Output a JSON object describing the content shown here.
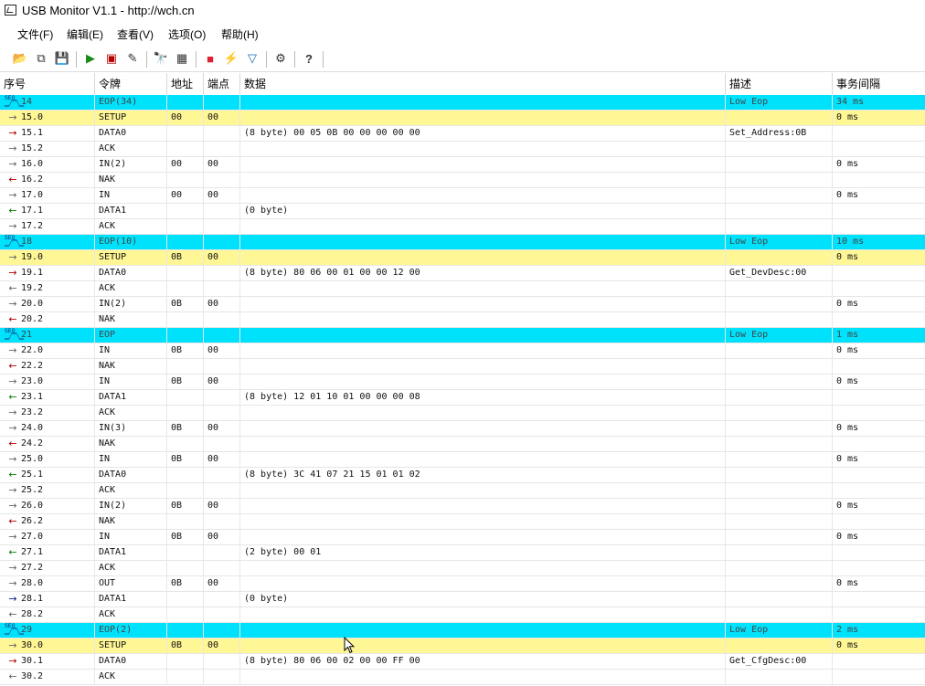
{
  "window": {
    "title": "USB Monitor V1.1 - http://wch.cn"
  },
  "menu": [
    "文件(F)",
    "编辑(E)",
    "查看(V)",
    "选项(O)",
    "帮助(H)"
  ],
  "toolbar": [
    {
      "icon": "open-folder-icon",
      "glyph": "📂"
    },
    {
      "icon": "export-icon",
      "glyph": "⧉"
    },
    {
      "icon": "save-icon",
      "glyph": "💾"
    },
    {
      "icon": "start-capture-icon",
      "glyph": "▶"
    },
    {
      "icon": "stop-capture-icon",
      "glyph": "▣"
    },
    {
      "icon": "edit-filter-icon",
      "glyph": "✎"
    },
    {
      "icon": "find-icon",
      "glyph": "🔭"
    },
    {
      "icon": "grid-view-icon",
      "glyph": "▦"
    },
    {
      "icon": "color-settings-icon",
      "glyph": "■"
    },
    {
      "icon": "trigger-icon",
      "glyph": "⚡"
    },
    {
      "icon": "filter-icon",
      "glyph": "▽"
    },
    {
      "icon": "properties-icon",
      "glyph": "⚙"
    },
    {
      "icon": "help-icon",
      "glyph": "?"
    }
  ],
  "columns": [
    "序号",
    "令牌",
    "地址",
    "端点",
    "数据",
    "描述",
    "事务间隔"
  ],
  "rows": [
    {
      "type": "eop",
      "seq": "14",
      "token": "EOP(34)",
      "addr": "",
      "ep": "",
      "data": "",
      "desc": "Low Eop",
      "gap": "34 ms"
    },
    {
      "type": "setup",
      "dir": "setup",
      "seq": "15.0",
      "token": "SETUP",
      "addr": "00",
      "ep": "00",
      "data": "",
      "desc": "",
      "gap": "0 ms"
    },
    {
      "type": "normal",
      "dir": "out",
      "seq": "15.1",
      "token": "DATA0",
      "addr": "",
      "ep": "",
      "data": "(8 byte) 00 05 0B 00 00 00 00 00",
      "desc": "Set_Address:0B",
      "gap": ""
    },
    {
      "type": "normal",
      "dir": "ack",
      "seq": "15.2",
      "token": "ACK",
      "addr": "",
      "ep": "",
      "data": "",
      "desc": "",
      "gap": ""
    },
    {
      "type": "normal",
      "dir": "ack",
      "seq": "16.0",
      "token": "IN(2)",
      "addr": "00",
      "ep": "00",
      "data": "",
      "desc": "",
      "gap": "0 ms"
    },
    {
      "type": "normal",
      "dir": "out-l",
      "seq": "16.2",
      "token": "NAK",
      "addr": "",
      "ep": "",
      "data": "",
      "desc": "",
      "gap": ""
    },
    {
      "type": "normal",
      "dir": "ack",
      "seq": "17.0",
      "token": "IN",
      "addr": "00",
      "ep": "00",
      "data": "",
      "desc": "",
      "gap": "0 ms"
    },
    {
      "type": "normal",
      "dir": "in",
      "seq": "17.1",
      "token": "DATA1",
      "addr": "",
      "ep": "",
      "data": "(0 byte)",
      "desc": "",
      "gap": ""
    },
    {
      "type": "normal",
      "dir": "ack",
      "seq": "17.2",
      "token": "ACK",
      "addr": "",
      "ep": "",
      "data": "",
      "desc": "",
      "gap": ""
    },
    {
      "type": "eop",
      "seq": "18",
      "token": "EOP(10)",
      "addr": "",
      "ep": "",
      "data": "",
      "desc": "Low Eop",
      "gap": "10 ms"
    },
    {
      "type": "setup",
      "dir": "setup",
      "seq": "19.0",
      "token": "SETUP",
      "addr": "0B",
      "ep": "00",
      "data": "",
      "desc": "",
      "gap": "0 ms"
    },
    {
      "type": "normal",
      "dir": "out",
      "seq": "19.1",
      "token": "DATA0",
      "addr": "",
      "ep": "",
      "data": "(8 byte) 80 06 00 01 00 00 12 00",
      "desc": "Get_DevDesc:00",
      "gap": ""
    },
    {
      "type": "normal",
      "dir": "ack-l",
      "seq": "19.2",
      "token": "ACK",
      "addr": "",
      "ep": "",
      "data": "",
      "desc": "",
      "gap": ""
    },
    {
      "type": "normal",
      "dir": "ack",
      "seq": "20.0",
      "token": "IN(2)",
      "addr": "0B",
      "ep": "00",
      "data": "",
      "desc": "",
      "gap": "0 ms"
    },
    {
      "type": "normal",
      "dir": "out-l",
      "seq": "20.2",
      "token": "NAK",
      "addr": "",
      "ep": "",
      "data": "",
      "desc": "",
      "gap": ""
    },
    {
      "type": "eop",
      "seq": "21",
      "token": "EOP",
      "addr": "",
      "ep": "",
      "data": "",
      "desc": "Low Eop",
      "gap": "1 ms"
    },
    {
      "type": "normal",
      "dir": "ack",
      "seq": "22.0",
      "token": "IN",
      "addr": "0B",
      "ep": "00",
      "data": "",
      "desc": "",
      "gap": "0 ms"
    },
    {
      "type": "normal",
      "dir": "out-l",
      "seq": "22.2",
      "token": "NAK",
      "addr": "",
      "ep": "",
      "data": "",
      "desc": "",
      "gap": ""
    },
    {
      "type": "normal",
      "dir": "ack",
      "seq": "23.0",
      "token": "IN",
      "addr": "0B",
      "ep": "00",
      "data": "",
      "desc": "",
      "gap": "0 ms"
    },
    {
      "type": "normal",
      "dir": "in",
      "seq": "23.1",
      "token": "DATA1",
      "addr": "",
      "ep": "",
      "data": "(8 byte) 12 01 10 01 00 00 00 08",
      "desc": "",
      "gap": ""
    },
    {
      "type": "normal",
      "dir": "ack",
      "seq": "23.2",
      "token": "ACK",
      "addr": "",
      "ep": "",
      "data": "",
      "desc": "",
      "gap": ""
    },
    {
      "type": "normal",
      "dir": "ack",
      "seq": "24.0",
      "token": "IN(3)",
      "addr": "0B",
      "ep": "00",
      "data": "",
      "desc": "",
      "gap": "0 ms"
    },
    {
      "type": "normal",
      "dir": "out-l",
      "seq": "24.2",
      "token": "NAK",
      "addr": "",
      "ep": "",
      "data": "",
      "desc": "",
      "gap": ""
    },
    {
      "type": "normal",
      "dir": "ack",
      "seq": "25.0",
      "token": "IN",
      "addr": "0B",
      "ep": "00",
      "data": "",
      "desc": "",
      "gap": "0 ms"
    },
    {
      "type": "normal",
      "dir": "in",
      "seq": "25.1",
      "token": "DATA0",
      "addr": "",
      "ep": "",
      "data": "(8 byte) 3C 41 07 21 15 01 01 02",
      "desc": "",
      "gap": ""
    },
    {
      "type": "normal",
      "dir": "ack",
      "seq": "25.2",
      "token": "ACK",
      "addr": "",
      "ep": "",
      "data": "",
      "desc": "",
      "gap": ""
    },
    {
      "type": "normal",
      "dir": "ack",
      "seq": "26.0",
      "token": "IN(2)",
      "addr": "0B",
      "ep": "00",
      "data": "",
      "desc": "",
      "gap": "0 ms"
    },
    {
      "type": "normal",
      "dir": "out-l",
      "seq": "26.2",
      "token": "NAK",
      "addr": "",
      "ep": "",
      "data": "",
      "desc": "",
      "gap": ""
    },
    {
      "type": "normal",
      "dir": "ack",
      "seq": "27.0",
      "token": "IN",
      "addr": "0B",
      "ep": "00",
      "data": "",
      "desc": "",
      "gap": "0 ms"
    },
    {
      "type": "normal",
      "dir": "in",
      "seq": "27.1",
      "token": "DATA1",
      "addr": "",
      "ep": "",
      "data": "(2 byte) 00 01",
      "desc": "",
      "gap": ""
    },
    {
      "type": "normal",
      "dir": "ack",
      "seq": "27.2",
      "token": "ACK",
      "addr": "",
      "ep": "",
      "data": "",
      "desc": "",
      "gap": ""
    },
    {
      "type": "normal",
      "dir": "ack",
      "seq": "28.0",
      "token": "OUT",
      "addr": "0B",
      "ep": "00",
      "data": "",
      "desc": "",
      "gap": "0 ms"
    },
    {
      "type": "normal",
      "dir": "blue",
      "seq": "28.1",
      "token": "DATA1",
      "addr": "",
      "ep": "",
      "data": "(0 byte)",
      "desc": "",
      "gap": ""
    },
    {
      "type": "normal",
      "dir": "ack-l",
      "seq": "28.2",
      "token": "ACK",
      "addr": "",
      "ep": "",
      "data": "",
      "desc": "",
      "gap": ""
    },
    {
      "type": "eop",
      "seq": "29",
      "token": "EOP(2)",
      "addr": "",
      "ep": "",
      "data": "",
      "desc": "Low Eop",
      "gap": "2 ms"
    },
    {
      "type": "setup",
      "dir": "setup",
      "seq": "30.0",
      "token": "SETUP",
      "addr": "0B",
      "ep": "00",
      "data": "",
      "desc": "",
      "gap": "0 ms"
    },
    {
      "type": "normal",
      "dir": "out",
      "seq": "30.1",
      "token": "DATA0",
      "addr": "",
      "ep": "",
      "data": "(8 byte) 80 06 00 02 00 00 FF 00",
      "desc": "Get_CfgDesc:00",
      "gap": ""
    },
    {
      "type": "normal",
      "dir": "ack-l",
      "seq": "30.2",
      "token": "ACK",
      "addr": "",
      "ep": "",
      "data": "",
      "desc": "",
      "gap": ""
    }
  ]
}
